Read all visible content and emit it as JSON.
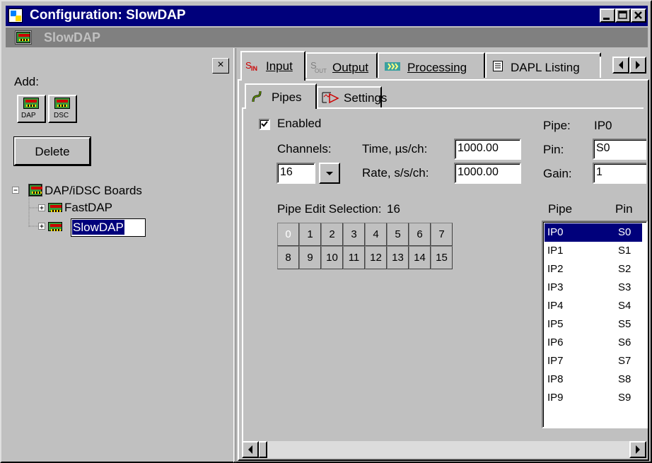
{
  "window": {
    "title": "Configuration: SlowDAP"
  },
  "subheader": {
    "title": "SlowDAP"
  },
  "left": {
    "add_label": "Add:",
    "dap_label": "DAP",
    "dsc_label": "DSC",
    "delete_label": "Delete",
    "close_glyph": "×",
    "tree": {
      "root": "DAP/iDSC Boards",
      "children": [
        "FastDAP",
        "SlowDAP"
      ],
      "editing": "SlowDAP"
    }
  },
  "tabs": {
    "input": "Input",
    "output": "Output",
    "processing": "Processing",
    "dapl": "DAPL Listing"
  },
  "subtabs": {
    "pipes": "Pipes",
    "settings": "Settings"
  },
  "form": {
    "enabled_label": "Enabled",
    "enabled_checked": true,
    "channels_label": "Channels:",
    "channels_value": "16",
    "time_label": "Time, µs/ch:",
    "time_value": "1000.00",
    "rate_label": "Rate, s/s/ch:",
    "rate_value": "1000.00",
    "pipe_label": "Pipe:",
    "pipe_value": "IP0",
    "pin_label": "Pin:",
    "pin_value": "S0",
    "gain_label": "Gain:",
    "gain_value": "1",
    "selection_label": "Pipe Edit Selection:",
    "selection_value": "16"
  },
  "grid": [
    [
      "0",
      "1",
      "2",
      "3",
      "4",
      "5",
      "6",
      "7"
    ],
    [
      "8",
      "9",
      "10",
      "11",
      "12",
      "13",
      "14",
      "15"
    ]
  ],
  "list": {
    "headers": [
      "Pipe",
      "Pin"
    ],
    "rows": [
      [
        "IP0",
        "S0"
      ],
      [
        "IP1",
        "S1"
      ],
      [
        "IP2",
        "S2"
      ],
      [
        "IP3",
        "S3"
      ],
      [
        "IP4",
        "S4"
      ],
      [
        "IP5",
        "S5"
      ],
      [
        "IP6",
        "S6"
      ],
      [
        "IP7",
        "S7"
      ],
      [
        "IP8",
        "S8"
      ],
      [
        "IP9",
        "S9"
      ]
    ],
    "selected_index": 0
  },
  "colors": {
    "selection": "#00007b",
    "titlebar": "#00007b",
    "face": "#c0c0c0"
  }
}
